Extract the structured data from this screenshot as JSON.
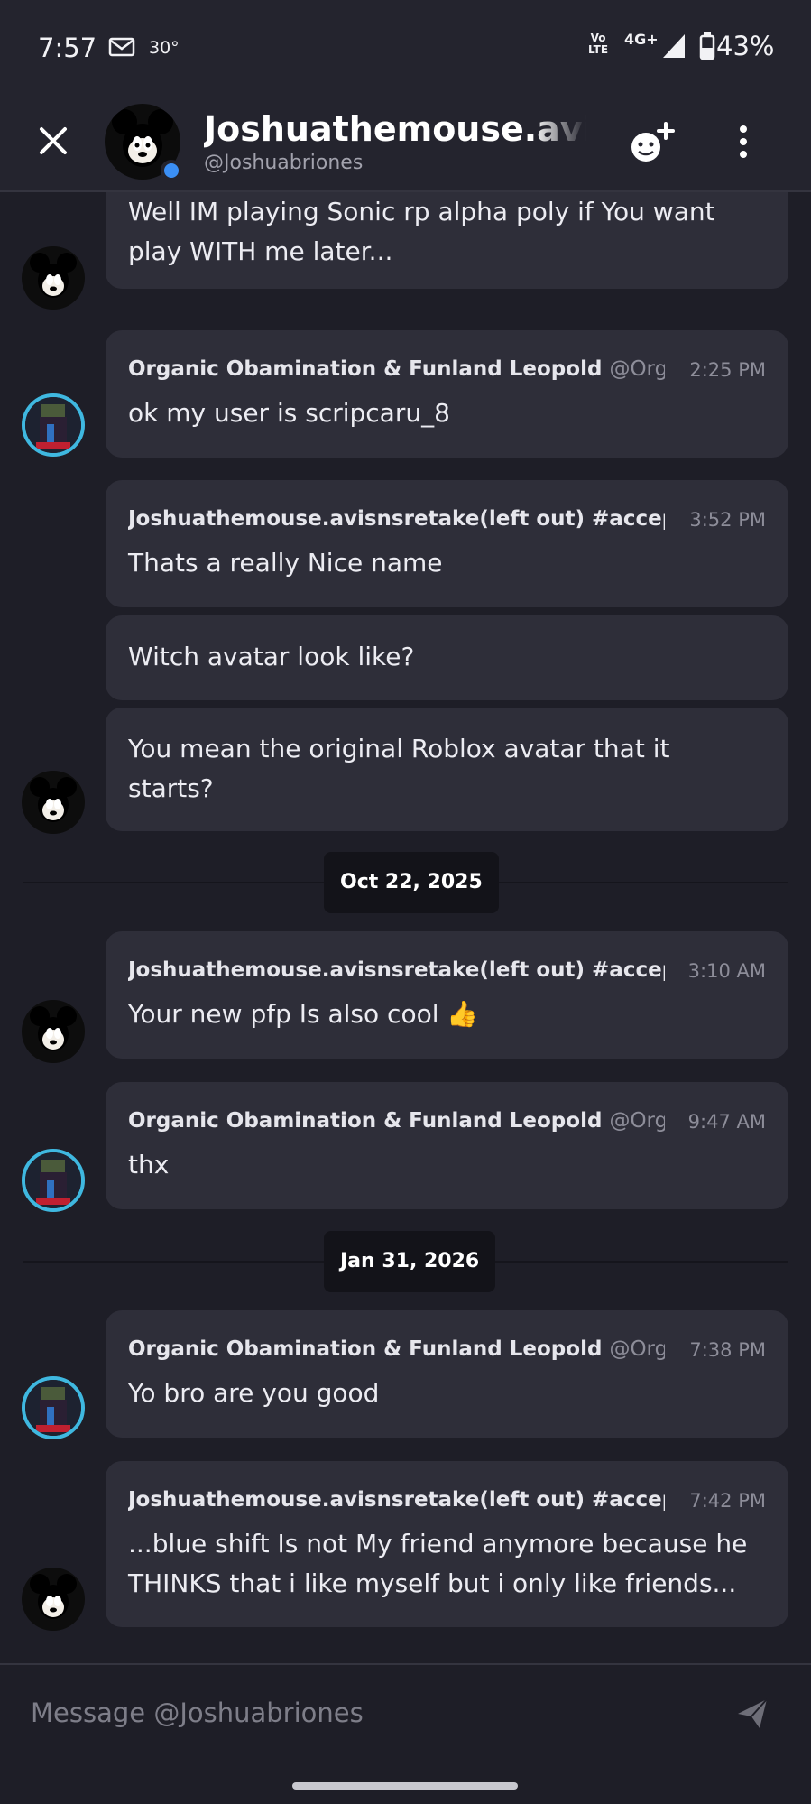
{
  "status_bar": {
    "time": "7:57",
    "temperature": "30°",
    "volte_top": "Vo",
    "volte_bottom": "LTE",
    "network": "4G+",
    "battery": "43%"
  },
  "header": {
    "name": "Joshuathemouse.avisnsretake(left out) #accep",
    "handle": "@Joshuabriones"
  },
  "messages": [
    {
      "author": "",
      "tag": "",
      "time": "",
      "lines": [
        "Well IM playing Sonic rp alpha poly if You want",
        "play WITH me later..."
      ]
    },
    {
      "author": "Organic Obamination & Funland Leopold",
      "tag": "@Org",
      "time": "2:25 PM",
      "lines": [
        "ok my user is scripcaru_8"
      ]
    },
    {
      "author": "Joshuathemouse.avisnsretake(left out) #accep",
      "tag": "",
      "time": "3:52 PM",
      "lines": [
        "Thats a really Nice name"
      ]
    },
    {
      "author": "",
      "tag": "",
      "time": "",
      "lines": [
        "Witch avatar look like?"
      ]
    },
    {
      "author": "",
      "tag": "",
      "time": "",
      "lines": [
        "You mean the original Roblox avatar that it",
        "starts?"
      ]
    },
    {
      "author": "Joshuathemouse.avisnsretake(left out) #accep",
      "tag": "",
      "time": "3:10 AM",
      "lines": [
        "Your new pfp Is also cool 👍"
      ]
    },
    {
      "author": "Organic Obamination & Funland Leopold",
      "tag": "@Org",
      "time": "9:47 AM",
      "lines": [
        "thx"
      ]
    },
    {
      "author": "Organic Obamination & Funland Leopold",
      "tag": "@Org",
      "time": "7:38 PM",
      "lines": [
        "Yo  bro are you good"
      ]
    },
    {
      "author": "Joshuathemouse.avisnsretake(left out) #accep",
      "tag": "",
      "time": "7:42 PM",
      "lines": [
        "...blue shift Is not My friend anymore because he",
        "THINKS that i like myself but i only like friends..."
      ]
    }
  ],
  "dates": [
    "Oct 22, 2025",
    "Jan 31, 2026"
  ],
  "composer": {
    "placeholder": "Message @Joshuabriones"
  },
  "colors": {
    "background": "#1e1e27",
    "bubble": "#2e2e39",
    "online": "#3b8ff5",
    "organic_ring": "#3fb8e0"
  },
  "icons": [
    "close-icon",
    "add-friend-icon",
    "more-vertical-icon",
    "send-icon",
    "mail-icon",
    "signal-icon",
    "battery-icon"
  ]
}
